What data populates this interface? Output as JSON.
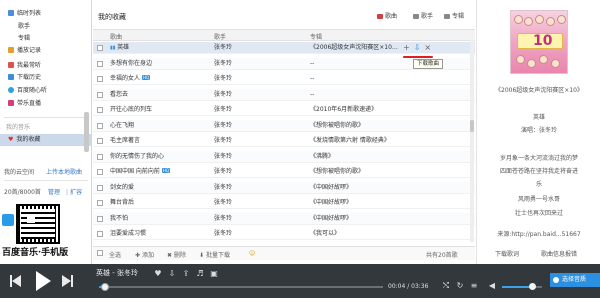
{
  "sidebar": {
    "items": [
      {
        "label": "临时列表",
        "type": "main",
        "icon_color": "#4a90d9"
      },
      {
        "label": "歌手",
        "type": "sub"
      },
      {
        "label": "专辑",
        "type": "sub"
      },
      {
        "label": "播放记录",
        "type": "main",
        "icon_color": "#e0a030"
      },
      {
        "label": "我最常听",
        "type": "main",
        "icon_color": "#e05050"
      },
      {
        "label": "下载历史",
        "type": "main",
        "icon_color": "#3a8fd6"
      },
      {
        "label": "百度随心听",
        "type": "main",
        "icon_color": "#2fa0e0"
      },
      {
        "label": "带乐直播",
        "type": "main",
        "icon_color": "#d04080"
      }
    ],
    "section_label": "我的音乐",
    "favorites_label": "我的收藏",
    "cloud_label": "我的云空间",
    "upload_label": "上传本地歌曲",
    "storage_text": "20首/8000首",
    "manage_label": "管理",
    "expand_label": "扩容",
    "brand_text": "百度音乐·手机版"
  },
  "main": {
    "page_title": "我的收藏",
    "view_buttons": [
      {
        "label": "歌曲"
      },
      {
        "label": "歌手"
      },
      {
        "label": "专辑"
      }
    ],
    "columns": {
      "title": "歌曲",
      "artist": "歌手",
      "album": "专辑"
    },
    "rows": [
      {
        "title": "英雄",
        "artist": "张冬玲",
        "album": "《2006超级女声沈阳赛区×10…",
        "hq": false,
        "selected": true
      },
      {
        "title": "多想有你在身边",
        "artist": "张冬玲",
        "album": "--",
        "hq": false
      },
      {
        "title": "幸福的女人",
        "artist": "张冬玲",
        "album": "--",
        "hq": true
      },
      {
        "title": "看您去",
        "artist": "张冬玲",
        "album": "--",
        "hq": false
      },
      {
        "title": "开往心底的列车",
        "artist": "张冬玲",
        "album": "《2010年6月新歌速递》",
        "hq": false
      },
      {
        "title": "心在飞翔",
        "artist": "张冬玲",
        "album": "《想你被唱你的歌》",
        "hq": false
      },
      {
        "title": "毛主席著言",
        "artist": "张冬玲",
        "album": "《发烧情歌第六射 情歌经典》",
        "hq": false
      },
      {
        "title": "你的无情伤了我的心",
        "artist": "张冬玲",
        "album": "《沸腾》",
        "hq": false
      },
      {
        "title": "中国中国 向前向前",
        "artist": "张冬玲",
        "album": "《想你被唱你的歌》",
        "hq": true
      },
      {
        "title": "剑女的爱",
        "artist": "张冬玲",
        "album": "《中国好故啰》",
        "hq": false
      },
      {
        "title": "舞台背后",
        "artist": "张冬玲",
        "album": "《中国好故啰》",
        "hq": false
      },
      {
        "title": "我不怕",
        "artist": "张冬玲",
        "album": "《中国好故啰》",
        "hq": false
      },
      {
        "title": "沮要爱成习惯",
        "artist": "张冬玲",
        "album": "《我可以》",
        "hq": false
      }
    ],
    "row_ops": [
      "+",
      "⇩",
      "×"
    ],
    "tooltip": "下载歌曲",
    "footer": {
      "select_all": "全选",
      "add": "添加",
      "delete": "删除",
      "batch_download": "批量下载",
      "count_text": "共有20首歌"
    }
  },
  "right_panel": {
    "album_caption": "《2006超级女声沈阳赛区×10》",
    "song_name": "英雄",
    "singer_line": "演唱：张冬玲",
    "lyrics": [
      "岁月象一条大河流淌过我的梦",
      "四面苍苍路在坚持我走将奋进",
      "乐",
      "风雨勇一号水哥",
      "壮士也再次回来过"
    ],
    "source_text": "来源:http://pan.baid...51667",
    "download_lyrics": "下载歌词",
    "lyric_settings": "歌曲信息报错"
  },
  "player": {
    "now_playing": "英雄 - 张冬玲",
    "time_text": "00:04 / 03:36",
    "progress": 0.02,
    "volume": 0.75,
    "playlist_button": "选择音质",
    "accent_color": "#3aa0e8"
  }
}
